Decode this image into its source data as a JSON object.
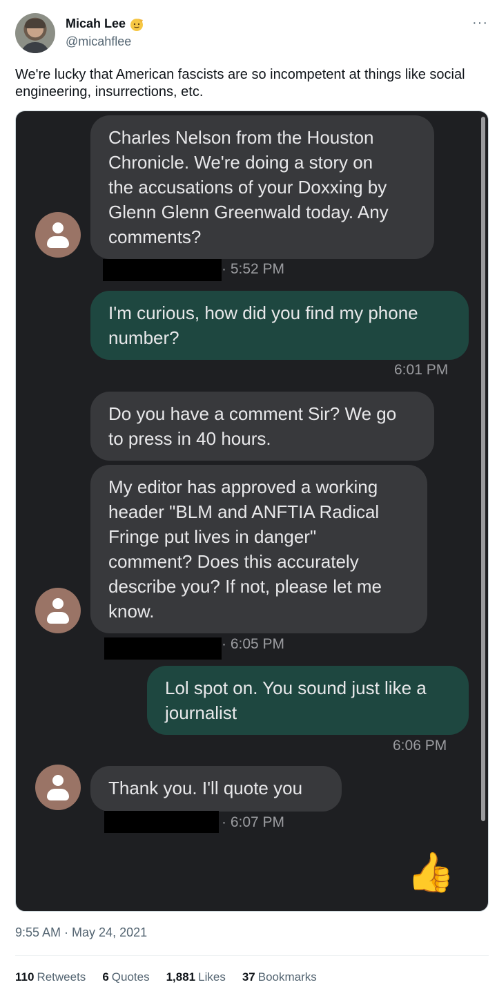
{
  "author": {
    "name": "Micah Lee",
    "handle": "@micahflee"
  },
  "more_icon": "···",
  "tweet_text": "We're lucky that American fascists are so incompetent at things like social engineering, insurrections, etc.",
  "messages": [
    {
      "type": "in",
      "text": "Charles Nelson from the Houston\nChronicle. We're doing a story on\nthe accusations of your Doxxing by\nGlenn Glenn Greenwald today. Any\ncomments?",
      "time": "· 5:52 PM"
    },
    {
      "type": "out",
      "text": "I'm curious, how did you find my phone\nnumber?",
      "time": "6:01 PM"
    },
    {
      "type": "in",
      "text": "Do you have a comment Sir? We go\nto press in 40 hours."
    },
    {
      "type": "in",
      "text": "My editor has approved a working\nheader \"BLM and ANFTIA Radical\nFringe put lives in danger\"\ncomment? Does this accurately\ndescribe you? If not, please let me\nknow.",
      "time": "· 6:05 PM"
    },
    {
      "type": "out",
      "text": "Lol spot on. You sound just like a\njournalist",
      "time": "6:06 PM"
    },
    {
      "type": "in",
      "text": "Thank you. I'll quote you",
      "time": "· 6:07 PM"
    }
  ],
  "reaction_icon": "thumbs-up-icon",
  "reaction_glyph": "👍",
  "timestamp": "9:55 AM · May 24, 2021",
  "stats": [
    {
      "count": "110",
      "label": "Retweets"
    },
    {
      "count": "6",
      "label": "Quotes"
    },
    {
      "count": "1,881",
      "label": "Likes"
    },
    {
      "count": "37",
      "label": "Bookmarks"
    }
  ],
  "colors": {
    "incoming_bubble": "#38393c",
    "outgoing_bubble": "#1e4740",
    "chat_background": "#1e1f22",
    "contact_avatar": "#9a7466"
  }
}
